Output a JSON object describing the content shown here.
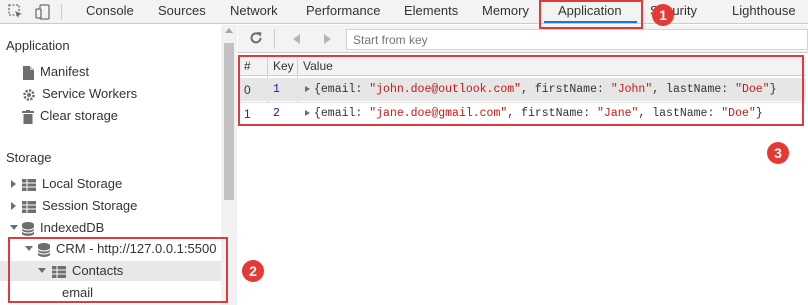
{
  "tabs": [
    {
      "label": "Console"
    },
    {
      "label": "Sources"
    },
    {
      "label": "Network"
    },
    {
      "label": "Performance"
    },
    {
      "label": "Elements"
    },
    {
      "label": "Memory"
    },
    {
      "label": "Application",
      "active": true
    },
    {
      "label": "Security"
    },
    {
      "label": "Lighthouse"
    }
  ],
  "annotations": [
    "1",
    "2",
    "3"
  ],
  "sidebar": {
    "application_title": "Application",
    "application_items": [
      {
        "label": "Manifest",
        "icon": "file-icon"
      },
      {
        "label": "Service Workers",
        "icon": "gear-icon"
      },
      {
        "label": "Clear storage",
        "icon": "trash-icon"
      }
    ],
    "storage_title": "Storage",
    "storage_items": [
      {
        "label": "Local Storage",
        "icon": "grid-icon"
      },
      {
        "label": "Session Storage",
        "icon": "grid-icon"
      },
      {
        "label": "IndexedDB",
        "icon": "database-icon"
      },
      {
        "label": "CRM - http://127.0.0.1:5500",
        "icon": "database-icon"
      },
      {
        "label": "Contacts",
        "icon": "grid-icon"
      },
      {
        "label": "email"
      }
    ]
  },
  "toolbar": {
    "search_placeholder": "Start from key"
  },
  "table": {
    "headers": [
      "#",
      "Key",
      "Value"
    ],
    "rows": [
      {
        "index": "0",
        "key": "1",
        "email": "\"john.doe@outlook.com\"",
        "firstName": "\"John\"",
        "lastName": "\"Doe\""
      },
      {
        "index": "1",
        "key": "2",
        "email": "\"jane.doe@gmail.com\"",
        "firstName": "\"Jane\"",
        "lastName": "\"Doe\""
      }
    ],
    "field_names": {
      "email": "email",
      "firstName": "firstName",
      "lastName": "lastName"
    }
  },
  "colors": {
    "annotation": "#e53935",
    "active_tab_underline": "#1a73e8",
    "string_value": "#c41a16",
    "key_value": "#1a1aa6"
  }
}
